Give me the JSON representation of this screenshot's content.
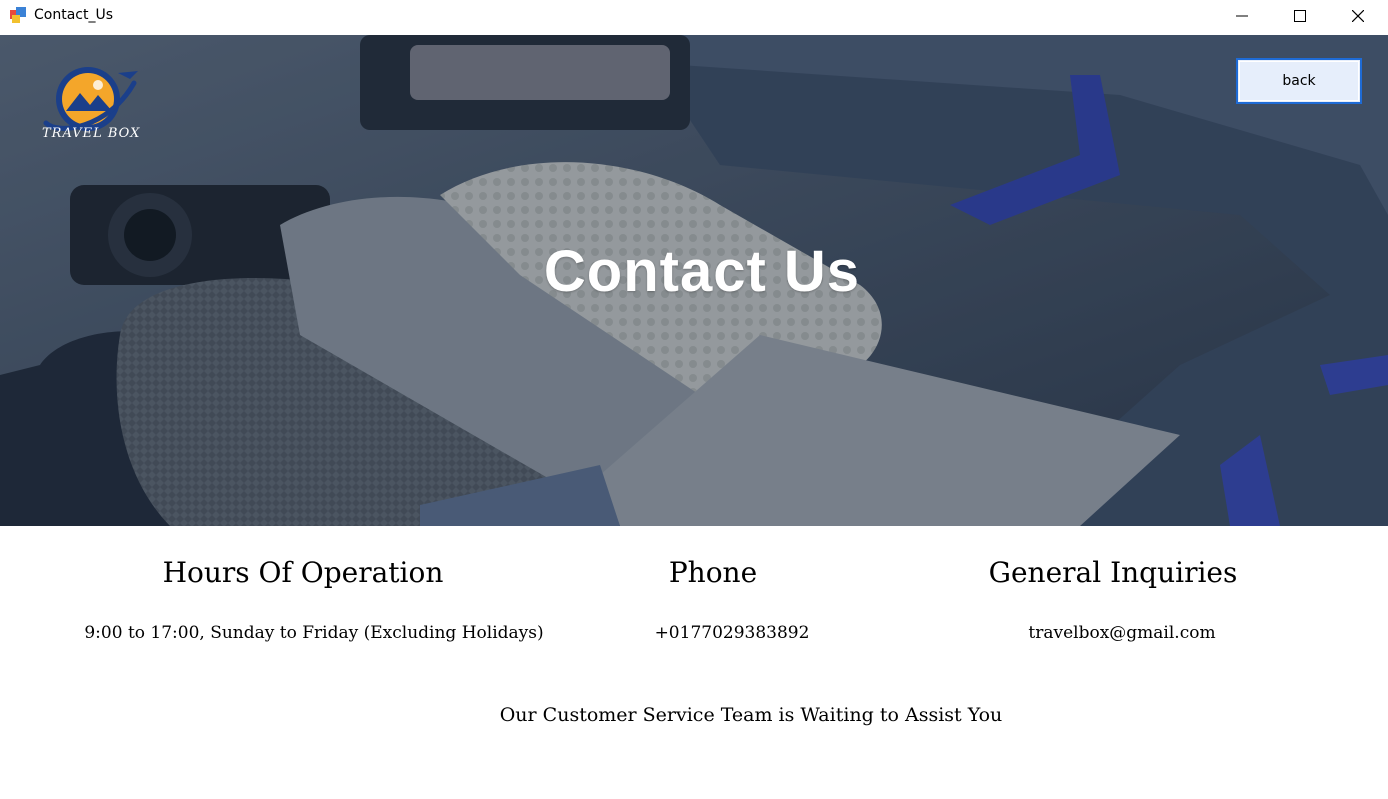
{
  "window": {
    "title": "Contact_Us",
    "icons": {
      "app": "app-window-icon",
      "minimize": "minimize-icon",
      "maximize": "maximize-icon",
      "close": "close-icon"
    }
  },
  "header": {
    "logo_text": "TRAVEL BOX",
    "title": "Contact Us",
    "back_label": "back"
  },
  "info": {
    "hours_title": "Hours Of Operation",
    "hours_text": "9:00 to 17:00, Sunday to Friday (Excluding Holidays)",
    "phone_title": "Phone",
    "phone_text": "+0177029383892",
    "inquiries_title": "General Inquiries",
    "inquiries_text": "travelbox@gmail.com"
  },
  "footer": {
    "message": "Our Customer Service Team is Waiting to Assist You"
  },
  "colors": {
    "hero_overlay": "#2c3e55",
    "back_border": "#1e6bd6",
    "logo_orange": "#f4a62a",
    "logo_blue": "#1b3f8a"
  }
}
